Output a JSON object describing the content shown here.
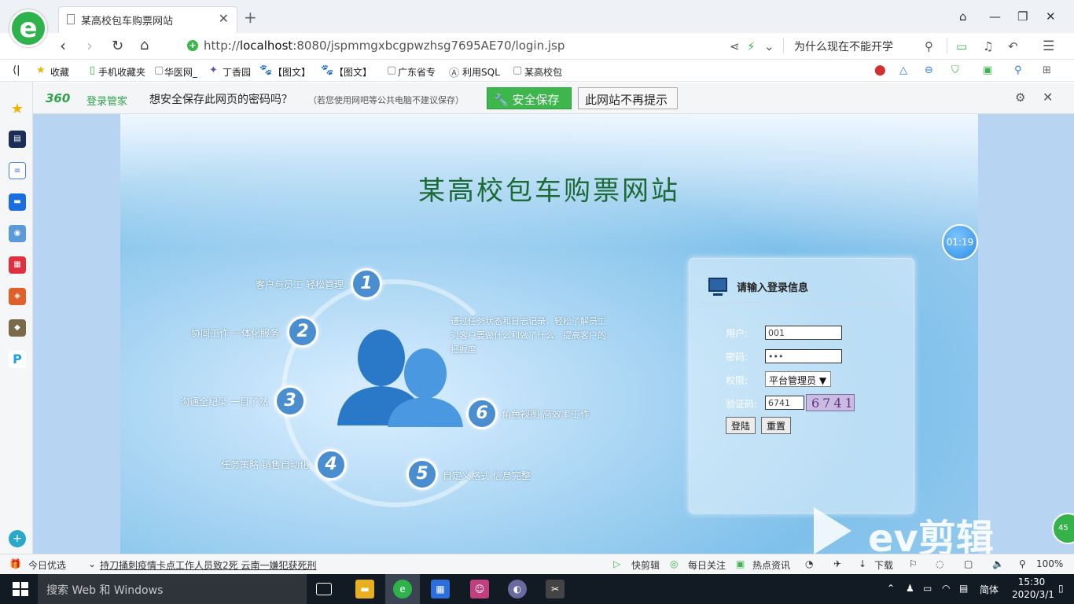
{
  "browser": {
    "tab_title": "某高校包车购票网站",
    "url_prefix": "http://",
    "url_host": "localhost",
    "url_rest": ":8080/jspmmgxbcgpwzhsg7695AE70/login.jsp",
    "search_text": "为什么现在不能开学"
  },
  "bookmarks": [
    "收藏",
    "手机收藏夹",
    "华医网_",
    "丁香园",
    "【图文】",
    "【图文】",
    "广东省专",
    "利用SQL",
    "某高校包"
  ],
  "password_bar": {
    "brand": "360",
    "brand_sub": "登录管家",
    "message": "想安全保存此网页的密码吗？",
    "hint": "（若您使用网吧等公共电脑不建议保存）",
    "save_label": "安全保存",
    "never_label": "此网站不再提示"
  },
  "page": {
    "title": "某高校包车购票网站",
    "features": [
      {
        "num": "1",
        "text": "客户与员工 轻松管理"
      },
      {
        "num": "2",
        "text": "协同工作 一体化服务"
      },
      {
        "num": "3",
        "text": "沟通全纪录 一目了然"
      },
      {
        "num": "4",
        "text": "任务策略 销售自动化"
      },
      {
        "num": "5",
        "text": "自定义格式 信息完整"
      },
      {
        "num": "6",
        "text": "角色视图 高效率工作"
      }
    ],
    "quote": "通过任务状态和日志记录，轻松了解员工对客户要做什么和做了什么，提高客户的把握度"
  },
  "login": {
    "heading": "请输入登录信息",
    "user_label": "用户:",
    "user_value": "001",
    "password_label": "密码:",
    "password_value": "•••",
    "role_label": "权限:",
    "role_value": "平台管理员 ▼",
    "captcha_label": "验证码:",
    "captcha_value": "6741",
    "captcha_image_text": "6741",
    "login_button": "登陆",
    "reset_button": "重置"
  },
  "overlay": {
    "timer": "01:19",
    "watermark": "ev剪辑",
    "badge": "45"
  },
  "statusbar": {
    "today": "今日优选",
    "news": "持刀捅刺疫情卡点工作人员致2死 云南一嫌犯获死刑",
    "quick_edit": "快剪辑",
    "daily": "每日关注",
    "hot": "热点资讯",
    "download": "下载",
    "zoom": "100%"
  },
  "taskbar": {
    "search_placeholder": "搜索 Web 和 Windows",
    "ime": "简体",
    "time": "15:30",
    "date": "2020/3/1"
  },
  "colors": {
    "accent_green": "#3db64b",
    "title_green": "#1c6a36",
    "stage_blue": "#7ec0ea"
  }
}
